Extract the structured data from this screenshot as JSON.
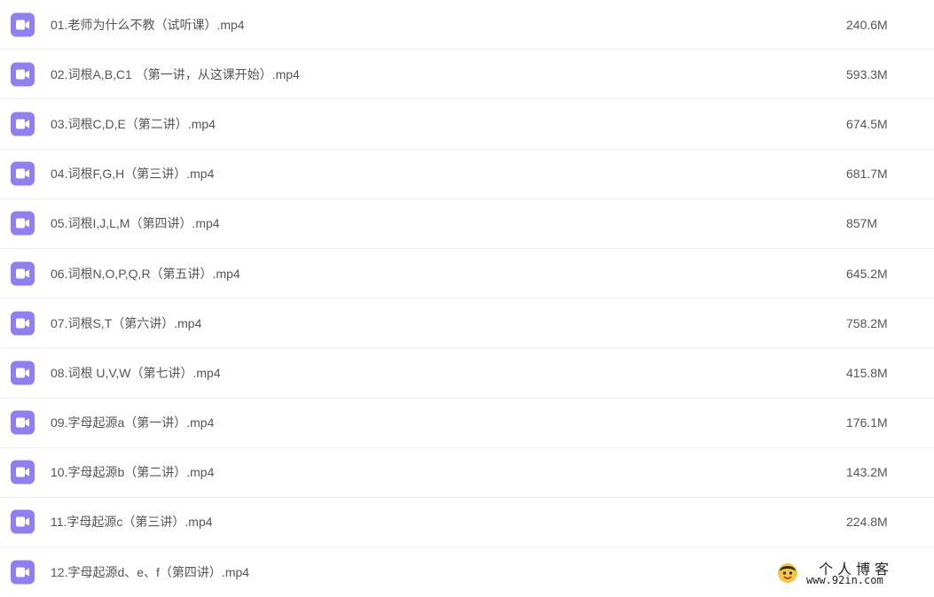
{
  "icon_color": "#8f7ff3",
  "files": [
    {
      "icon": "video-file-icon",
      "name": "01.老师为什么不教（试听课）.mp4",
      "size": "240.6M"
    },
    {
      "icon": "video-file-icon",
      "name": "02.词根A,B,C1 （第一讲，从这课开始）.mp4",
      "size": "593.3M"
    },
    {
      "icon": "video-file-icon",
      "name": "03.词根C,D,E（第二讲）.mp4",
      "size": "674.5M"
    },
    {
      "icon": "video-file-icon",
      "name": "04.词根F,G,H（第三讲）.mp4",
      "size": "681.7M"
    },
    {
      "icon": "video-file-icon",
      "name": "05.词根I,J,L,M（第四讲）.mp4",
      "size": "857M"
    },
    {
      "icon": "video-file-icon",
      "name": "06.词根N,O,P,Q,R（第五讲）.mp4",
      "size": "645.2M"
    },
    {
      "icon": "video-file-icon",
      "name": "07.词根S,T（第六讲）.mp4",
      "size": "758.2M"
    },
    {
      "icon": "video-file-icon",
      "name": "08.词根 U,V,W（第七讲）.mp4",
      "size": "415.8M"
    },
    {
      "icon": "video-file-icon",
      "name": "09.字母起源a（第一讲）.mp4",
      "size": "176.1M"
    },
    {
      "icon": "video-file-icon",
      "name": "10.字母起源b（第二讲）.mp4",
      "size": "143.2M"
    },
    {
      "icon": "video-file-icon",
      "name": "11.字母起源c（第三讲）.mp4",
      "size": "224.8M"
    },
    {
      "icon": "video-file-icon",
      "name": "12.字母起源d、e、f（第四讲）.mp4",
      "size": ""
    }
  ],
  "watermark": {
    "title": "个人博客",
    "url": "www.92in.com"
  }
}
